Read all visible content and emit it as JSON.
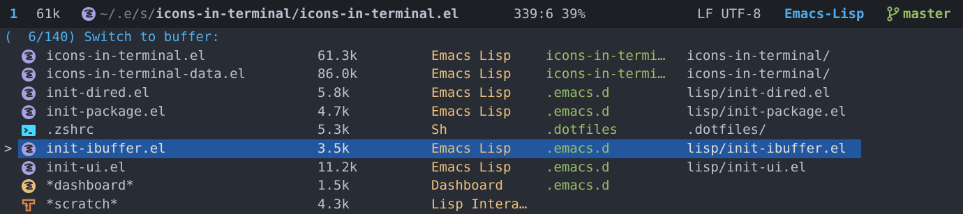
{
  "colors": {
    "background": "#282c34",
    "modeline_bg": "#1c1f24",
    "accent": "#51afef",
    "project": "#98be65",
    "major_mode": "#ECBE7B",
    "selection": "#2257a0",
    "emacs_icon": "#a9a1e1",
    "dashboard_icon": "#ECBE7B",
    "scratch_icon": "#da8548",
    "terminal_icon": "#46D9FF"
  },
  "modeline": {
    "window_number": "1",
    "buffer_size": "61k",
    "file_icon": "emacs-icon",
    "path_dim": "~/.e/s/",
    "path_project": "icons-in-terminal/",
    "path_file": "icons-in-terminal.el",
    "position": "339:6 39%",
    "encoding": "LF UTF-8",
    "major_mode": "Emacs-Lisp",
    "vcs_icon": "git-branch-icon",
    "vcs_branch": "master"
  },
  "prompt": "(  6/140) Switch to buffer:",
  "buffers": [
    {
      "icon": "emacs-icon",
      "name": "icons-in-terminal.el",
      "size": "61.3k",
      "mode": "Emacs Lisp",
      "project": "icons-in-termi…",
      "path": "icons-in-terminal/"
    },
    {
      "icon": "emacs-icon",
      "name": "icons-in-terminal-data.el",
      "size": "86.0k",
      "mode": "Emacs Lisp",
      "project": "icons-in-termi…",
      "path": "icons-in-terminal/"
    },
    {
      "icon": "emacs-icon",
      "name": "init-dired.el",
      "size": "5.8k",
      "mode": "Emacs Lisp",
      "project": ".emacs.d",
      "path": "lisp/init-dired.el"
    },
    {
      "icon": "emacs-icon",
      "name": "init-package.el",
      "size": "4.7k",
      "mode": "Emacs Lisp",
      "project": ".emacs.d",
      "path": "lisp/init-package.el"
    },
    {
      "icon": "terminal-icon",
      "name": ".zshrc",
      "size": "5.3k",
      "mode": "Sh",
      "project": ".dotfiles",
      "path": ".dotfiles/"
    },
    {
      "icon": "emacs-icon",
      "name": "init-ibuffer.el",
      "size": "3.5k",
      "mode": "Emacs Lisp",
      "project": ".emacs.d",
      "path": "lisp/init-ibuffer.el",
      "selected": true,
      "cursor": ">"
    },
    {
      "icon": "emacs-icon",
      "name": "init-ui.el",
      "size": "11.2k",
      "mode": "Emacs Lisp",
      "project": ".emacs.d",
      "path": "lisp/init-ui.el"
    },
    {
      "icon": "dashboard-emacs-icon",
      "name": "*dashboard*",
      "size": "1.5k",
      "mode": "Dashboard",
      "project": ".emacs.d",
      "path": ""
    },
    {
      "icon": "scratch-icon",
      "name": "*scratch*",
      "size": "4.3k",
      "mode": "Lisp Intera…",
      "project": "",
      "path": ""
    }
  ]
}
